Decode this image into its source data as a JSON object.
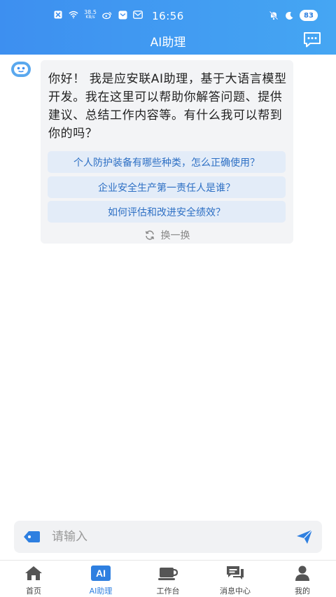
{
  "status_bar": {
    "network_speed_value": "38.5",
    "network_speed_unit": "KB/s",
    "time": "16:56",
    "battery": "83"
  },
  "header": {
    "title": "AI助理"
  },
  "chat": {
    "greeting": "你好！ 我是应安联AI助理，基于大语言模型开发。我在这里可以帮助你解答问题、提供建议、总结工作内容等。有什么我可以帮到你的吗？",
    "suggestions": [
      "个人防护装备有哪些种类，怎么正确使用？",
      "企业安全生产第一责任人是谁？",
      "如何评估和改进安全绩效？"
    ],
    "refresh_label": "换一换"
  },
  "input": {
    "placeholder": "请输入"
  },
  "tabs": [
    {
      "label": "首页",
      "icon": "home-icon",
      "active": false
    },
    {
      "label": "AI助理",
      "icon": "ai-icon",
      "active": true
    },
    {
      "label": "工作台",
      "icon": "workbench-icon",
      "active": false
    },
    {
      "label": "消息中心",
      "icon": "message-center-icon",
      "active": false
    },
    {
      "label": "我的",
      "icon": "profile-icon",
      "active": false
    }
  ],
  "colors": {
    "brand": "#3d8ff0",
    "accent": "#2e7fe0",
    "suggestion_bg": "#e3ecf8",
    "suggestion_text": "#2d6fc4",
    "bubble_bg": "#f3f4f6",
    "tab_inactive": "#555555"
  }
}
